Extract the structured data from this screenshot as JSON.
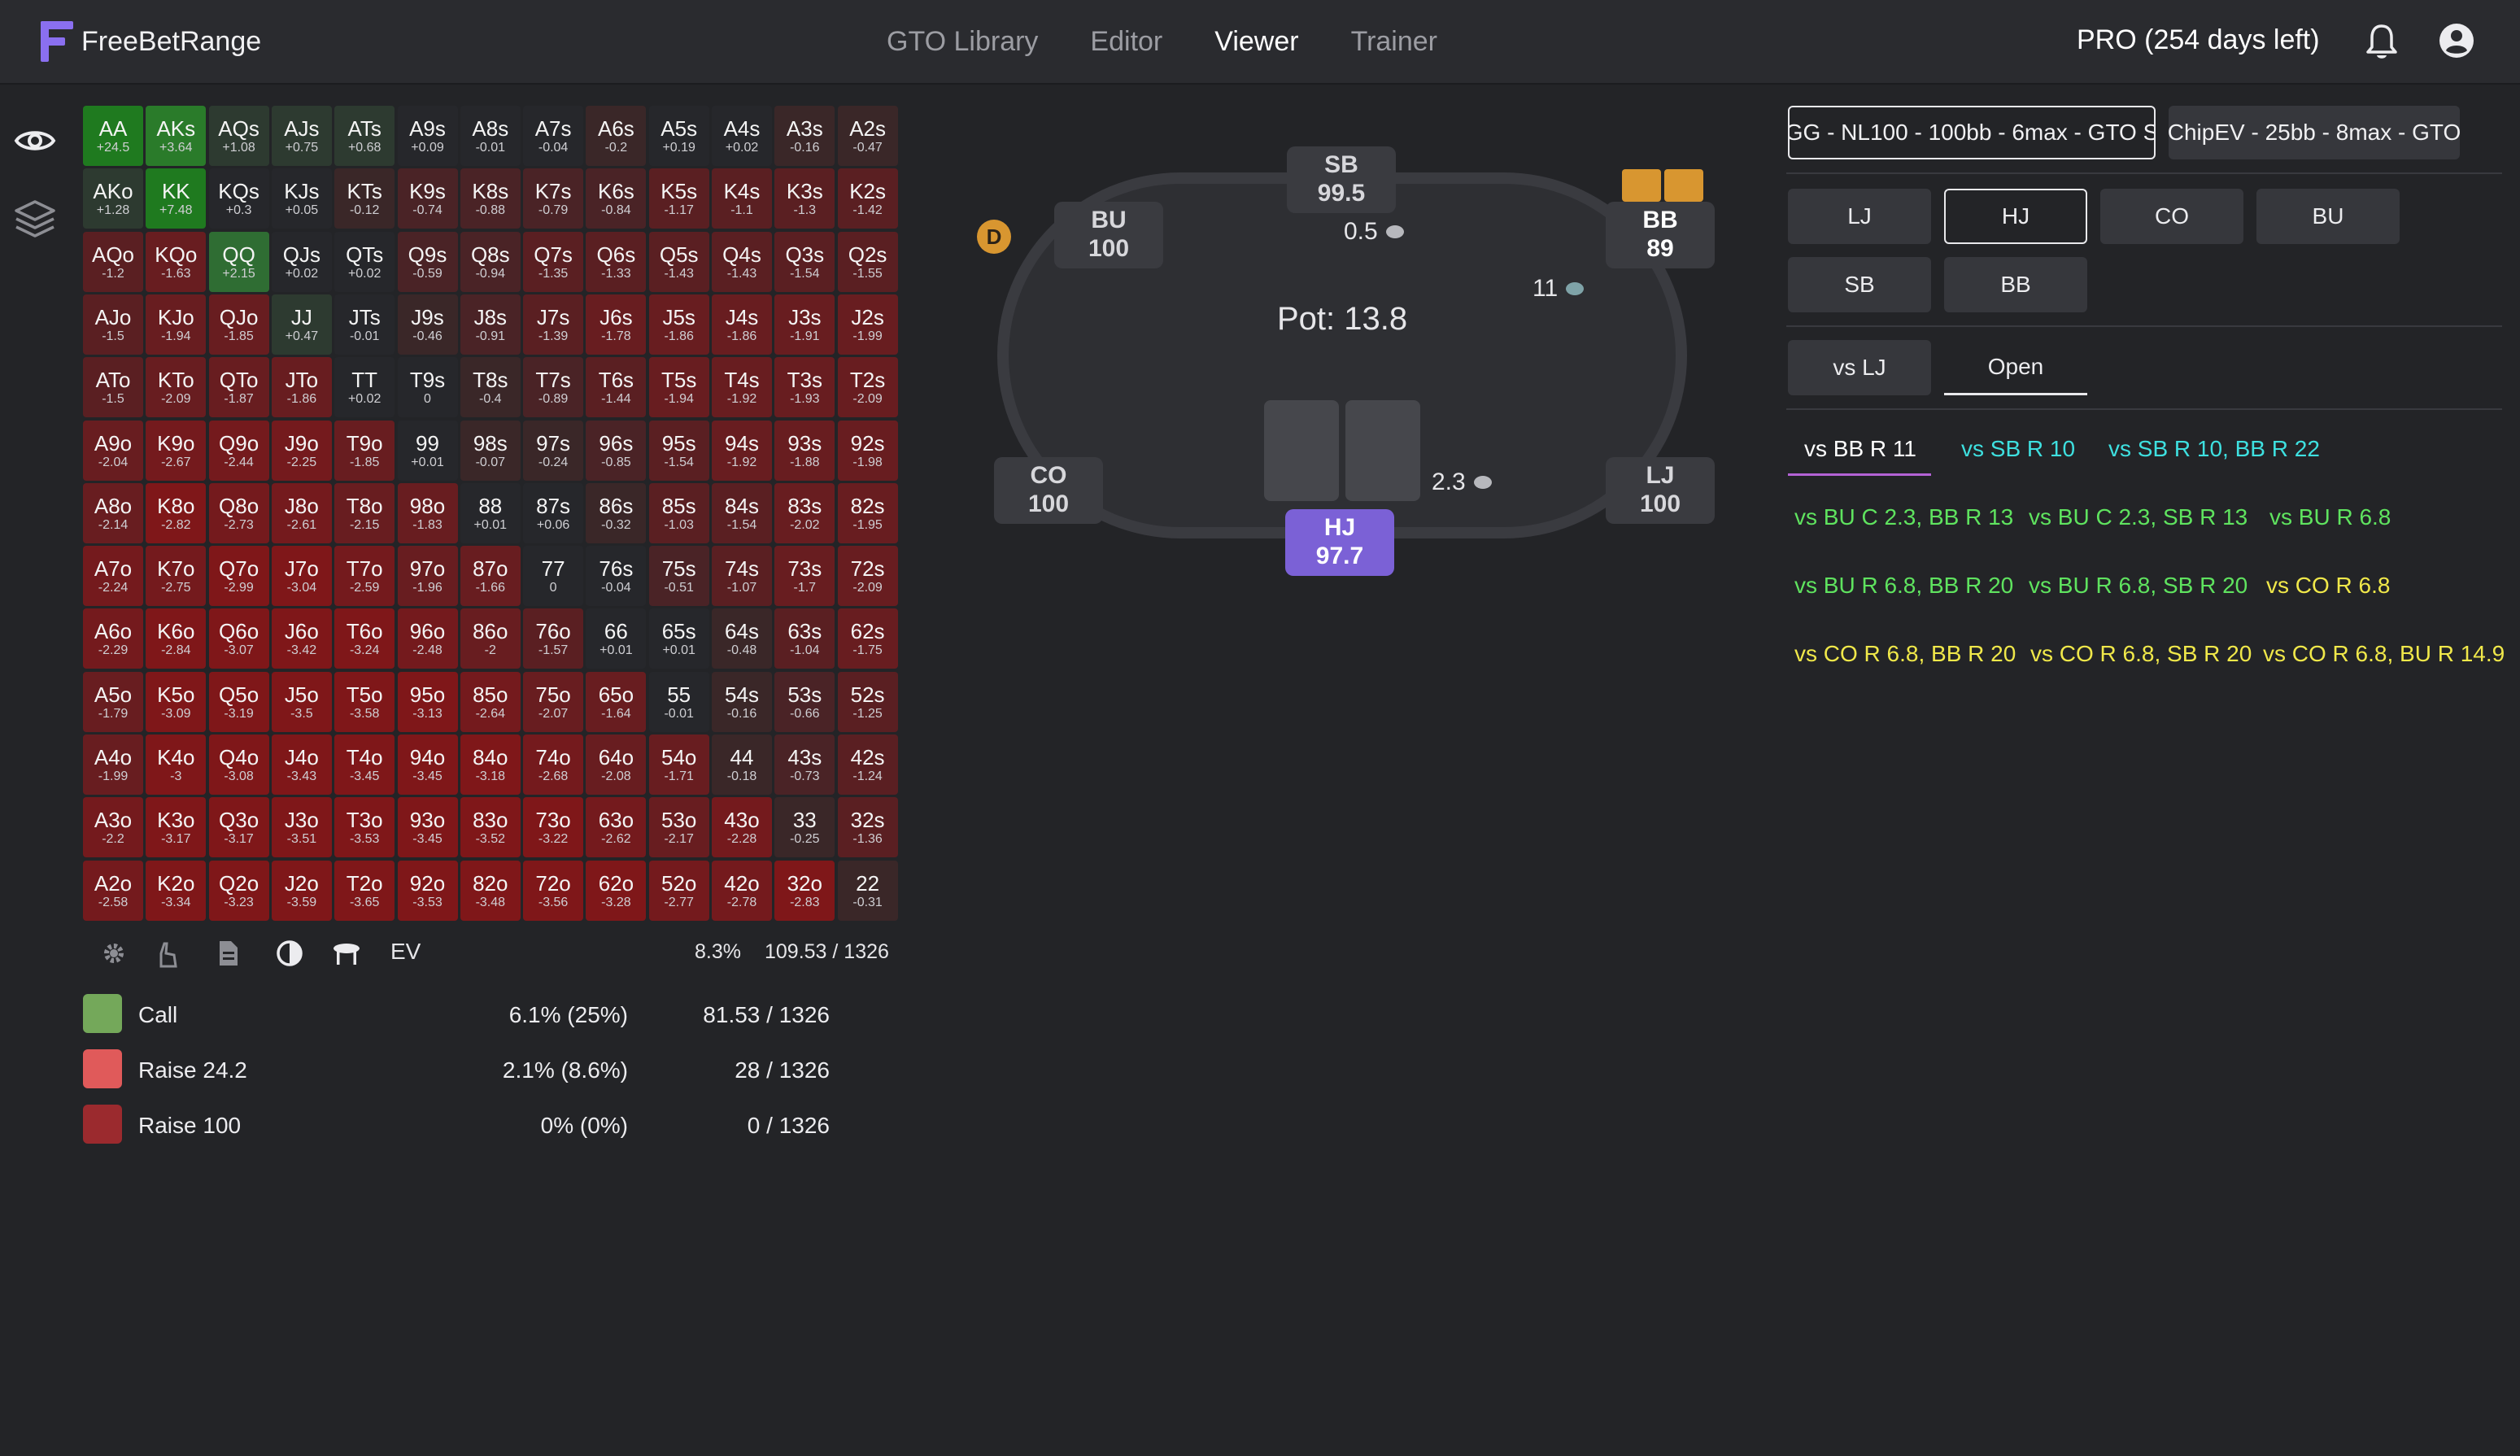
{
  "app": {
    "name": "FreeBetRange",
    "nav": [
      "GTO Library",
      "Editor",
      "Viewer",
      "Trainer"
    ],
    "active_nav": "Viewer",
    "plan": "PRO (254 days left)"
  },
  "colors": {
    "call": "#74a85a",
    "raise_small": "#e05a5a",
    "raise_all": "#9b2a2e",
    "hero": "#7b61d6",
    "dealer": "#d89630",
    "accent_underline": "#b463d6"
  },
  "grid": {
    "rows": [
      [
        [
          "AA",
          "+24.5"
        ],
        [
          "AKs",
          "+3.64"
        ],
        [
          "AQs",
          "+1.08"
        ],
        [
          "AJs",
          "+0.75"
        ],
        [
          "ATs",
          "+0.68"
        ],
        [
          "A9s",
          "+0.09"
        ],
        [
          "A8s",
          "-0.01"
        ],
        [
          "A7s",
          "-0.04"
        ],
        [
          "A6s",
          "-0.2"
        ],
        [
          "A5s",
          "+0.19"
        ],
        [
          "A4s",
          "+0.02"
        ],
        [
          "A3s",
          "-0.16"
        ],
        [
          "A2s",
          "-0.47"
        ]
      ],
      [
        [
          "AKo",
          "+1.28"
        ],
        [
          "KK",
          "+7.48"
        ],
        [
          "KQs",
          "+0.3"
        ],
        [
          "KJs",
          "+0.05"
        ],
        [
          "KTs",
          "-0.12"
        ],
        [
          "K9s",
          "-0.74"
        ],
        [
          "K8s",
          "-0.88"
        ],
        [
          "K7s",
          "-0.79"
        ],
        [
          "K6s",
          "-0.84"
        ],
        [
          "K5s",
          "-1.17"
        ],
        [
          "K4s",
          "-1.1"
        ],
        [
          "K3s",
          "-1.3"
        ],
        [
          "K2s",
          "-1.42"
        ]
      ],
      [
        [
          "AQo",
          "-1.2"
        ],
        [
          "KQo",
          "-1.63"
        ],
        [
          "QQ",
          "+2.15"
        ],
        [
          "QJs",
          "+0.02"
        ],
        [
          "QTs",
          "+0.02"
        ],
        [
          "Q9s",
          "-0.59"
        ],
        [
          "Q8s",
          "-0.94"
        ],
        [
          "Q7s",
          "-1.35"
        ],
        [
          "Q6s",
          "-1.33"
        ],
        [
          "Q5s",
          "-1.43"
        ],
        [
          "Q4s",
          "-1.43"
        ],
        [
          "Q3s",
          "-1.54"
        ],
        [
          "Q2s",
          "-1.55"
        ]
      ],
      [
        [
          "AJo",
          "-1.5"
        ],
        [
          "KJo",
          "-1.94"
        ],
        [
          "QJo",
          "-1.85"
        ],
        [
          "JJ",
          "+0.47"
        ],
        [
          "JTs",
          "-0.01"
        ],
        [
          "J9s",
          "-0.46"
        ],
        [
          "J8s",
          "-0.91"
        ],
        [
          "J7s",
          "-1.39"
        ],
        [
          "J6s",
          "-1.78"
        ],
        [
          "J5s",
          "-1.86"
        ],
        [
          "J4s",
          "-1.86"
        ],
        [
          "J3s",
          "-1.91"
        ],
        [
          "J2s",
          "-1.99"
        ]
      ],
      [
        [
          "ATo",
          "-1.5"
        ],
        [
          "KTo",
          "-2.09"
        ],
        [
          "QTo",
          "-1.87"
        ],
        [
          "JTo",
          "-1.86"
        ],
        [
          "TT",
          "+0.02"
        ],
        [
          "T9s",
          "0"
        ],
        [
          "T8s",
          "-0.4"
        ],
        [
          "T7s",
          "-0.89"
        ],
        [
          "T6s",
          "-1.44"
        ],
        [
          "T5s",
          "-1.94"
        ],
        [
          "T4s",
          "-1.92"
        ],
        [
          "T3s",
          "-1.93"
        ],
        [
          "T2s",
          "-2.09"
        ]
      ],
      [
        [
          "A9o",
          "-2.04"
        ],
        [
          "K9o",
          "-2.67"
        ],
        [
          "Q9o",
          "-2.44"
        ],
        [
          "J9o",
          "-2.25"
        ],
        [
          "T9o",
          "-1.85"
        ],
        [
          "99",
          "+0.01"
        ],
        [
          "98s",
          "-0.07"
        ],
        [
          "97s",
          "-0.24"
        ],
        [
          "96s",
          "-0.85"
        ],
        [
          "95s",
          "-1.54"
        ],
        [
          "94s",
          "-1.92"
        ],
        [
          "93s",
          "-1.88"
        ],
        [
          "92s",
          "-1.98"
        ]
      ],
      [
        [
          "A8o",
          "-2.14"
        ],
        [
          "K8o",
          "-2.82"
        ],
        [
          "Q8o",
          "-2.73"
        ],
        [
          "J8o",
          "-2.61"
        ],
        [
          "T8o",
          "-2.15"
        ],
        [
          "98o",
          "-1.83"
        ],
        [
          "88",
          "+0.01"
        ],
        [
          "87s",
          "+0.06"
        ],
        [
          "86s",
          "-0.32"
        ],
        [
          "85s",
          "-1.03"
        ],
        [
          "84s",
          "-1.54"
        ],
        [
          "83s",
          "-2.02"
        ],
        [
          "82s",
          "-1.95"
        ]
      ],
      [
        [
          "A7o",
          "-2.24"
        ],
        [
          "K7o",
          "-2.75"
        ],
        [
          "Q7o",
          "-2.99"
        ],
        [
          "J7o",
          "-3.04"
        ],
        [
          "T7o",
          "-2.59"
        ],
        [
          "97o",
          "-1.96"
        ],
        [
          "87o",
          "-1.66"
        ],
        [
          "77",
          "0"
        ],
        [
          "76s",
          "-0.04"
        ],
        [
          "75s",
          "-0.51"
        ],
        [
          "74s",
          "-1.07"
        ],
        [
          "73s",
          "-1.7"
        ],
        [
          "72s",
          "-2.09"
        ]
      ],
      [
        [
          "A6o",
          "-2.29"
        ],
        [
          "K6o",
          "-2.84"
        ],
        [
          "Q6o",
          "-3.07"
        ],
        [
          "J6o",
          "-3.42"
        ],
        [
          "T6o",
          "-3.24"
        ],
        [
          "96o",
          "-2.48"
        ],
        [
          "86o",
          "-2"
        ],
        [
          "76o",
          "-1.57"
        ],
        [
          "66",
          "+0.01"
        ],
        [
          "65s",
          "+0.01"
        ],
        [
          "64s",
          "-0.48"
        ],
        [
          "63s",
          "-1.04"
        ],
        [
          "62s",
          "-1.75"
        ]
      ],
      [
        [
          "A5o",
          "-1.79"
        ],
        [
          "K5o",
          "-3.09"
        ],
        [
          "Q5o",
          "-3.19"
        ],
        [
          "J5o",
          "-3.5"
        ],
        [
          "T5o",
          "-3.58"
        ],
        [
          "95o",
          "-3.13"
        ],
        [
          "85o",
          "-2.64"
        ],
        [
          "75o",
          "-2.07"
        ],
        [
          "65o",
          "-1.64"
        ],
        [
          "55",
          "-0.01"
        ],
        [
          "54s",
          "-0.16"
        ],
        [
          "53s",
          "-0.66"
        ],
        [
          "52s",
          "-1.25"
        ]
      ],
      [
        [
          "A4o",
          "-1.99"
        ],
        [
          "K4o",
          "-3"
        ],
        [
          "Q4o",
          "-3.08"
        ],
        [
          "J4o",
          "-3.43"
        ],
        [
          "T4o",
          "-3.45"
        ],
        [
          "94o",
          "-3.45"
        ],
        [
          "84o",
          "-3.18"
        ],
        [
          "74o",
          "-2.68"
        ],
        [
          "64o",
          "-2.08"
        ],
        [
          "54o",
          "-1.71"
        ],
        [
          "44",
          "-0.18"
        ],
        [
          "43s",
          "-0.73"
        ],
        [
          "42s",
          "-1.24"
        ]
      ],
      [
        [
          "A3o",
          "-2.2"
        ],
        [
          "K3o",
          "-3.17"
        ],
        [
          "Q3o",
          "-3.17"
        ],
        [
          "J3o",
          "-3.51"
        ],
        [
          "T3o",
          "-3.53"
        ],
        [
          "93o",
          "-3.45"
        ],
        [
          "83o",
          "-3.52"
        ],
        [
          "73o",
          "-3.22"
        ],
        [
          "63o",
          "-2.62"
        ],
        [
          "53o",
          "-2.17"
        ],
        [
          "43o",
          "-2.28"
        ],
        [
          "33",
          "-0.25"
        ],
        [
          "32s",
          "-1.36"
        ]
      ],
      [
        [
          "A2o",
          "-2.58"
        ],
        [
          "K2o",
          "-3.34"
        ],
        [
          "Q2o",
          "-3.23"
        ],
        [
          "J2o",
          "-3.59"
        ],
        [
          "T2o",
          "-3.65"
        ],
        [
          "92o",
          "-3.53"
        ],
        [
          "82o",
          "-3.48"
        ],
        [
          "72o",
          "-3.56"
        ],
        [
          "62o",
          "-3.28"
        ],
        [
          "52o",
          "-2.77"
        ],
        [
          "42o",
          "-2.78"
        ],
        [
          "32o",
          "-2.83"
        ],
        [
          "22",
          "-0.31"
        ]
      ]
    ]
  },
  "grid_toolbar": {
    "icons": [
      "gear-icon",
      "hand-icon",
      "document-icon",
      "contrast-icon",
      "table-icon"
    ],
    "mode_label": "EV",
    "percent_total": "8.3%",
    "combos_total": "109.53 / 1326"
  },
  "legend": [
    {
      "name": "Call",
      "pct": "6.1% (25%)",
      "combos": "81.53 / 1326",
      "color": "#74a85a"
    },
    {
      "name": "Raise 24.2",
      "pct": "2.1% (8.6%)",
      "combos": "28 / 1326",
      "color": "#e05a5a"
    },
    {
      "name": "Raise 100",
      "pct": "0% (0%)",
      "combos": "0 / 1326",
      "color": "#9b2a2e"
    }
  ],
  "table": {
    "pot": "Pot: 13.8",
    "seats": {
      "sb": {
        "name": "SB",
        "stack": "99.5",
        "bet": "0.5"
      },
      "bu": {
        "name": "BU",
        "stack": "100",
        "dealer": "D"
      },
      "bb": {
        "name": "BB",
        "stack": "89",
        "bet": "11"
      },
      "co": {
        "name": "CO",
        "stack": "100"
      },
      "lj": {
        "name": "LJ",
        "stack": "100"
      },
      "hj": {
        "name": "HJ",
        "stack": "97.7",
        "bet": "2.3"
      }
    }
  },
  "solutions": [
    {
      "label": "GG - NL100 - 100bb - 6max - GTO S",
      "active": true
    },
    {
      "label": "ChipEV - 25bb - 8max - GTO",
      "active": false
    }
  ],
  "positions": [
    "LJ",
    "HJ",
    "CO",
    "BU",
    "SB",
    "BB"
  ],
  "active_position": "HJ",
  "action_tabs": [
    "vs LJ",
    "Open"
  ],
  "active_action_tab": "Open",
  "lines": [
    {
      "label": "vs BB R 11",
      "color": "white",
      "selected": true
    },
    {
      "label": "vs SB R 10",
      "color": "cyan"
    },
    {
      "label": "vs SB R 10, BB R 22",
      "color": "cyan"
    },
    {
      "label": "vs BU C 2.3, BB R 13",
      "color": "green"
    },
    {
      "label": "vs BU C 2.3, SB R 13",
      "color": "green"
    },
    {
      "label": "vs BU R 6.8",
      "color": "green"
    },
    {
      "label": "vs BU R 6.8, BB R 20",
      "color": "green"
    },
    {
      "label": "vs BU R 6.8, SB R 20",
      "color": "green"
    },
    {
      "label": "vs CO R 6.8",
      "color": "yellow"
    },
    {
      "label": "vs CO R 6.8, BB R 20",
      "color": "yellow"
    },
    {
      "label": "vs CO R 6.8, SB R 20",
      "color": "yellow"
    },
    {
      "label": "vs CO R 6.8, BU R 14.9",
      "color": "yellow"
    }
  ]
}
